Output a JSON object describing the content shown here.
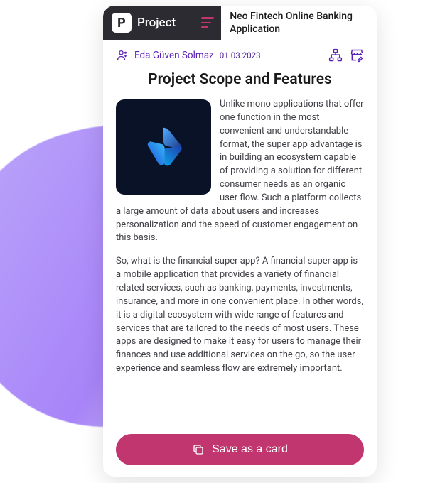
{
  "header": {
    "logo_letter": "P",
    "title": "Project",
    "subtitle": "Neo Fintech Online Banking Application"
  },
  "meta": {
    "author": "Eda Güven Solmaz",
    "date": "01.03.2023"
  },
  "content": {
    "title": "Project Scope and Features",
    "paragraph1": "Unlike mono applications that offer one function in the most convenient and understandable format, the super app advantage is in building an ecosystem capable of providing a solution for different consumer needs as an organic user flow. Such a platform collects a large amount of data about users and increases personalization and the speed of customer engagement on this basis.",
    "paragraph2": "So, what is the financial super app? A financial super app is a mobile application that provides a variety of financial related services, such as banking, payments, investments, insurance, and more in one convenient place. In other words, it is a digital ecosystem with wide range of features and services that are tailored to the needs of most users. These apps are designed to make it easy for users to manage their finances and use additional services on the go, so the user experience and seamless flow are extremely important."
  },
  "footer": {
    "save_label": "Save as a card"
  },
  "colors": {
    "accent": "#c2366f",
    "purple": "#5b21b6"
  }
}
